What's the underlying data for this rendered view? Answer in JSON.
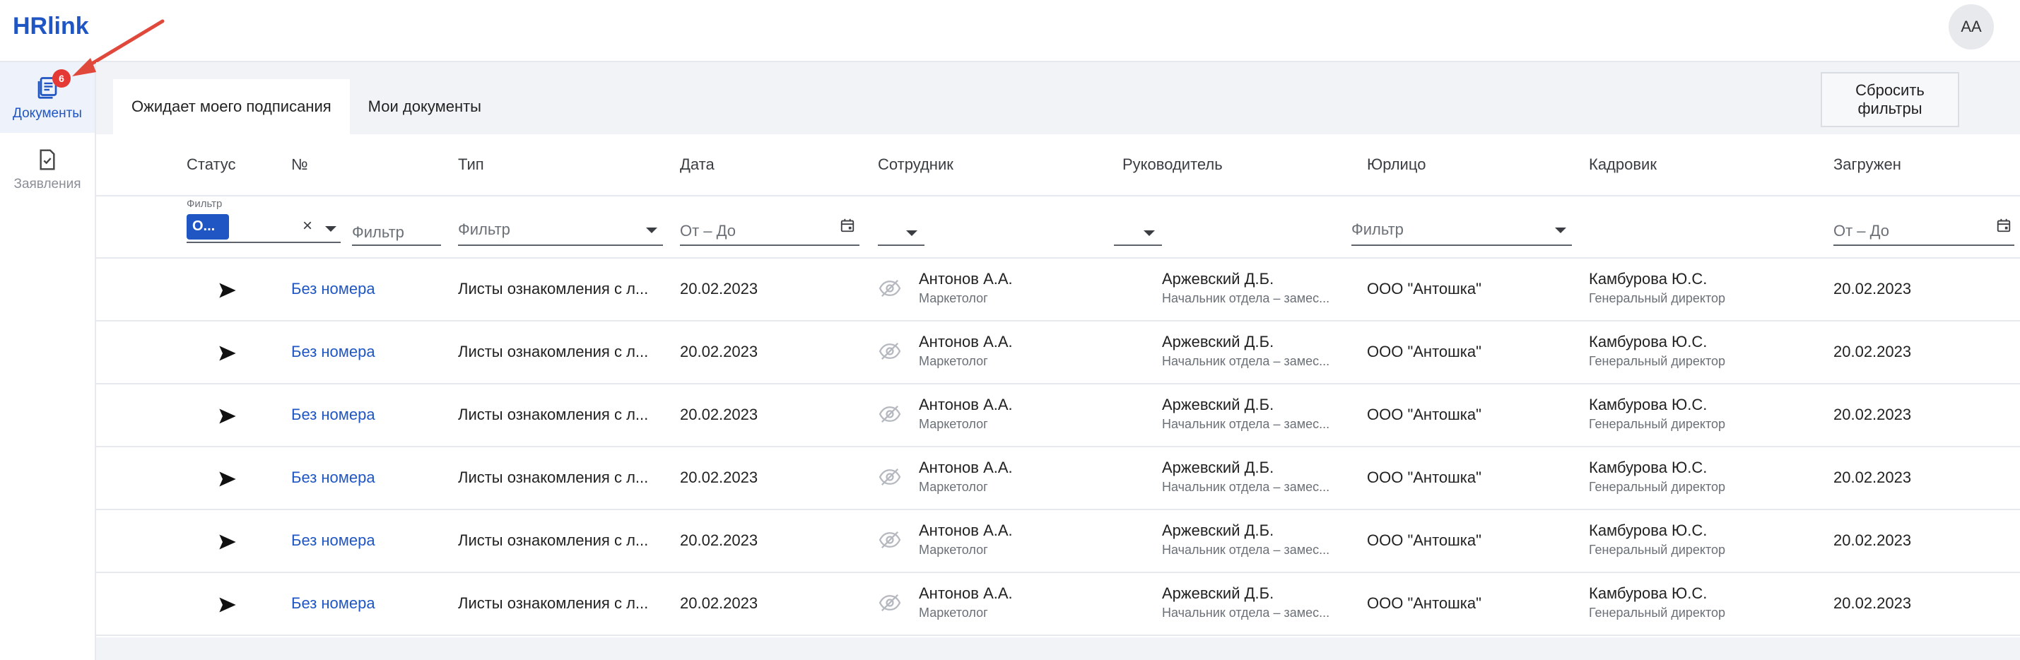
{
  "app": {
    "logo_text": "HRlink",
    "avatar_initials": "АА"
  },
  "sidebar": {
    "items": [
      {
        "label": "Документы",
        "icon": "documents-icon",
        "badge": "6",
        "active": true
      },
      {
        "label": "Заявления",
        "icon": "application-icon",
        "active": false
      }
    ]
  },
  "tabs": [
    {
      "label": "Ожидает моего подписания",
      "active": true
    },
    {
      "label": "Мои документы",
      "active": false
    }
  ],
  "reset_button": "Сбросить фильтры",
  "columns": [
    "Статус",
    "№",
    "Тип",
    "Дата",
    "Сотрудник",
    "Руководитель",
    "Юрлицо",
    "Кадровик",
    "Загружен"
  ],
  "filters": {
    "status_label": "Фильтр",
    "status_chip": "О...",
    "clear_symbol": "×",
    "number_placeholder": "Фильтр",
    "type_placeholder": "Фильтр",
    "date_placeholder": "От – До",
    "legal_placeholder": "Фильтр",
    "uploaded_placeholder": "От – До"
  },
  "rows": [
    {
      "number": "Без номера",
      "type": "Листы ознакомления с л...",
      "date": "20.02.2023",
      "employee": "Антонов А.А.",
      "employee_role": "Маркетолог",
      "manager": "Аржевский Д.Б.",
      "manager_role": "Начальник отдела – замес...",
      "legal": "ООО \"Антошка\"",
      "hr": "Камбурова Ю.С.",
      "hr_role": "Генеральный директор",
      "uploaded": "20.02.2023"
    },
    {
      "number": "Без номера",
      "type": "Листы ознакомления с л...",
      "date": "20.02.2023",
      "employee": "Антонов А.А.",
      "employee_role": "Маркетолог",
      "manager": "Аржевский Д.Б.",
      "manager_role": "Начальник отдела – замес...",
      "legal": "ООО \"Антошка\"",
      "hr": "Камбурова Ю.С.",
      "hr_role": "Генеральный директор",
      "uploaded": "20.02.2023"
    },
    {
      "number": "Без номера",
      "type": "Листы ознакомления с л...",
      "date": "20.02.2023",
      "employee": "Антонов А.А.",
      "employee_role": "Маркетолог",
      "manager": "Аржевский Д.Б.",
      "manager_role": "Начальник отдела – замес...",
      "legal": "ООО \"Антошка\"",
      "hr": "Камбурова Ю.С.",
      "hr_role": "Генеральный директор",
      "uploaded": "20.02.2023"
    },
    {
      "number": "Без номера",
      "type": "Листы ознакомления с л...",
      "date": "20.02.2023",
      "employee": "Антонов А.А.",
      "employee_role": "Маркетолог",
      "manager": "Аржевский Д.Б.",
      "manager_role": "Начальник отдела – замес...",
      "legal": "ООО \"Антошка\"",
      "hr": "Камбурова Ю.С.",
      "hr_role": "Генеральный директор",
      "uploaded": "20.02.2023"
    },
    {
      "number": "Без номера",
      "type": "Листы ознакомления с л...",
      "date": "20.02.2023",
      "employee": "Антонов А.А.",
      "employee_role": "Маркетолог",
      "manager": "Аржевский Д.Б.",
      "manager_role": "Начальник отдела – замес...",
      "legal": "ООО \"Антошка\"",
      "hr": "Камбурова Ю.С.",
      "hr_role": "Генеральный директор",
      "uploaded": "20.02.2023"
    },
    {
      "number": "Без номера",
      "type": "Листы ознакомления с л...",
      "date": "20.02.2023",
      "employee": "Антонов А.А.",
      "employee_role": "Маркетолог",
      "manager": "Аржевский Д.Б.",
      "manager_role": "Начальник отдела – замес...",
      "legal": "ООО \"Антошка\"",
      "hr": "Камбурова Ю.С.",
      "hr_role": "Генеральный директор",
      "uploaded": "20.02.2023"
    }
  ],
  "colors": {
    "accent": "#1f56c4",
    "badge": "#e53935",
    "annotation_arrow": "#e0483b"
  }
}
